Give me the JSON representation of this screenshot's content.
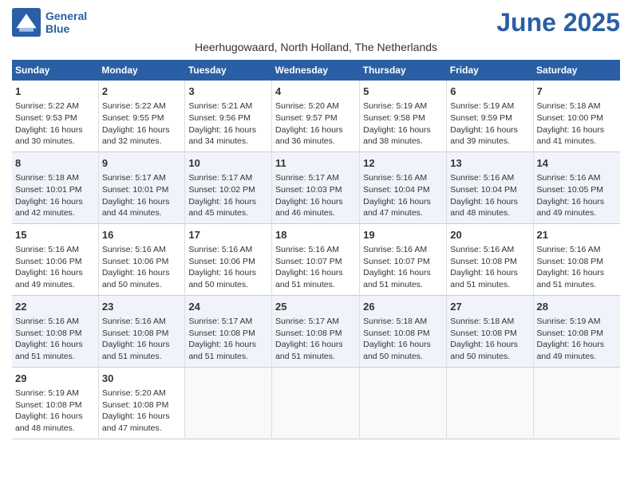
{
  "logo": {
    "line1": "General",
    "line2": "Blue"
  },
  "title": "June 2025",
  "subtitle": "Heerhugowaard, North Holland, The Netherlands",
  "days_of_week": [
    "Sunday",
    "Monday",
    "Tuesday",
    "Wednesday",
    "Thursday",
    "Friday",
    "Saturday"
  ],
  "weeks": [
    [
      {
        "day": "1",
        "info": "Sunrise: 5:22 AM\nSunset: 9:53 PM\nDaylight: 16 hours\nand 30 minutes."
      },
      {
        "day": "2",
        "info": "Sunrise: 5:22 AM\nSunset: 9:55 PM\nDaylight: 16 hours\nand 32 minutes."
      },
      {
        "day": "3",
        "info": "Sunrise: 5:21 AM\nSunset: 9:56 PM\nDaylight: 16 hours\nand 34 minutes."
      },
      {
        "day": "4",
        "info": "Sunrise: 5:20 AM\nSunset: 9:57 PM\nDaylight: 16 hours\nand 36 minutes."
      },
      {
        "day": "5",
        "info": "Sunrise: 5:19 AM\nSunset: 9:58 PM\nDaylight: 16 hours\nand 38 minutes."
      },
      {
        "day": "6",
        "info": "Sunrise: 5:19 AM\nSunset: 9:59 PM\nDaylight: 16 hours\nand 39 minutes."
      },
      {
        "day": "7",
        "info": "Sunrise: 5:18 AM\nSunset: 10:00 PM\nDaylight: 16 hours\nand 41 minutes."
      }
    ],
    [
      {
        "day": "8",
        "info": "Sunrise: 5:18 AM\nSunset: 10:01 PM\nDaylight: 16 hours\nand 42 minutes."
      },
      {
        "day": "9",
        "info": "Sunrise: 5:17 AM\nSunset: 10:01 PM\nDaylight: 16 hours\nand 44 minutes."
      },
      {
        "day": "10",
        "info": "Sunrise: 5:17 AM\nSunset: 10:02 PM\nDaylight: 16 hours\nand 45 minutes."
      },
      {
        "day": "11",
        "info": "Sunrise: 5:17 AM\nSunset: 10:03 PM\nDaylight: 16 hours\nand 46 minutes."
      },
      {
        "day": "12",
        "info": "Sunrise: 5:16 AM\nSunset: 10:04 PM\nDaylight: 16 hours\nand 47 minutes."
      },
      {
        "day": "13",
        "info": "Sunrise: 5:16 AM\nSunset: 10:04 PM\nDaylight: 16 hours\nand 48 minutes."
      },
      {
        "day": "14",
        "info": "Sunrise: 5:16 AM\nSunset: 10:05 PM\nDaylight: 16 hours\nand 49 minutes."
      }
    ],
    [
      {
        "day": "15",
        "info": "Sunrise: 5:16 AM\nSunset: 10:06 PM\nDaylight: 16 hours\nand 49 minutes."
      },
      {
        "day": "16",
        "info": "Sunrise: 5:16 AM\nSunset: 10:06 PM\nDaylight: 16 hours\nand 50 minutes."
      },
      {
        "day": "17",
        "info": "Sunrise: 5:16 AM\nSunset: 10:06 PM\nDaylight: 16 hours\nand 50 minutes."
      },
      {
        "day": "18",
        "info": "Sunrise: 5:16 AM\nSunset: 10:07 PM\nDaylight: 16 hours\nand 51 minutes."
      },
      {
        "day": "19",
        "info": "Sunrise: 5:16 AM\nSunset: 10:07 PM\nDaylight: 16 hours\nand 51 minutes."
      },
      {
        "day": "20",
        "info": "Sunrise: 5:16 AM\nSunset: 10:08 PM\nDaylight: 16 hours\nand 51 minutes."
      },
      {
        "day": "21",
        "info": "Sunrise: 5:16 AM\nSunset: 10:08 PM\nDaylight: 16 hours\nand 51 minutes."
      }
    ],
    [
      {
        "day": "22",
        "info": "Sunrise: 5:16 AM\nSunset: 10:08 PM\nDaylight: 16 hours\nand 51 minutes."
      },
      {
        "day": "23",
        "info": "Sunrise: 5:16 AM\nSunset: 10:08 PM\nDaylight: 16 hours\nand 51 minutes."
      },
      {
        "day": "24",
        "info": "Sunrise: 5:17 AM\nSunset: 10:08 PM\nDaylight: 16 hours\nand 51 minutes."
      },
      {
        "day": "25",
        "info": "Sunrise: 5:17 AM\nSunset: 10:08 PM\nDaylight: 16 hours\nand 51 minutes."
      },
      {
        "day": "26",
        "info": "Sunrise: 5:18 AM\nSunset: 10:08 PM\nDaylight: 16 hours\nand 50 minutes."
      },
      {
        "day": "27",
        "info": "Sunrise: 5:18 AM\nSunset: 10:08 PM\nDaylight: 16 hours\nand 50 minutes."
      },
      {
        "day": "28",
        "info": "Sunrise: 5:19 AM\nSunset: 10:08 PM\nDaylight: 16 hours\nand 49 minutes."
      }
    ],
    [
      {
        "day": "29",
        "info": "Sunrise: 5:19 AM\nSunset: 10:08 PM\nDaylight: 16 hours\nand 48 minutes."
      },
      {
        "day": "30",
        "info": "Sunrise: 5:20 AM\nSunset: 10:08 PM\nDaylight: 16 hours\nand 47 minutes."
      },
      {
        "day": "",
        "info": ""
      },
      {
        "day": "",
        "info": ""
      },
      {
        "day": "",
        "info": ""
      },
      {
        "day": "",
        "info": ""
      },
      {
        "day": "",
        "info": ""
      }
    ]
  ]
}
